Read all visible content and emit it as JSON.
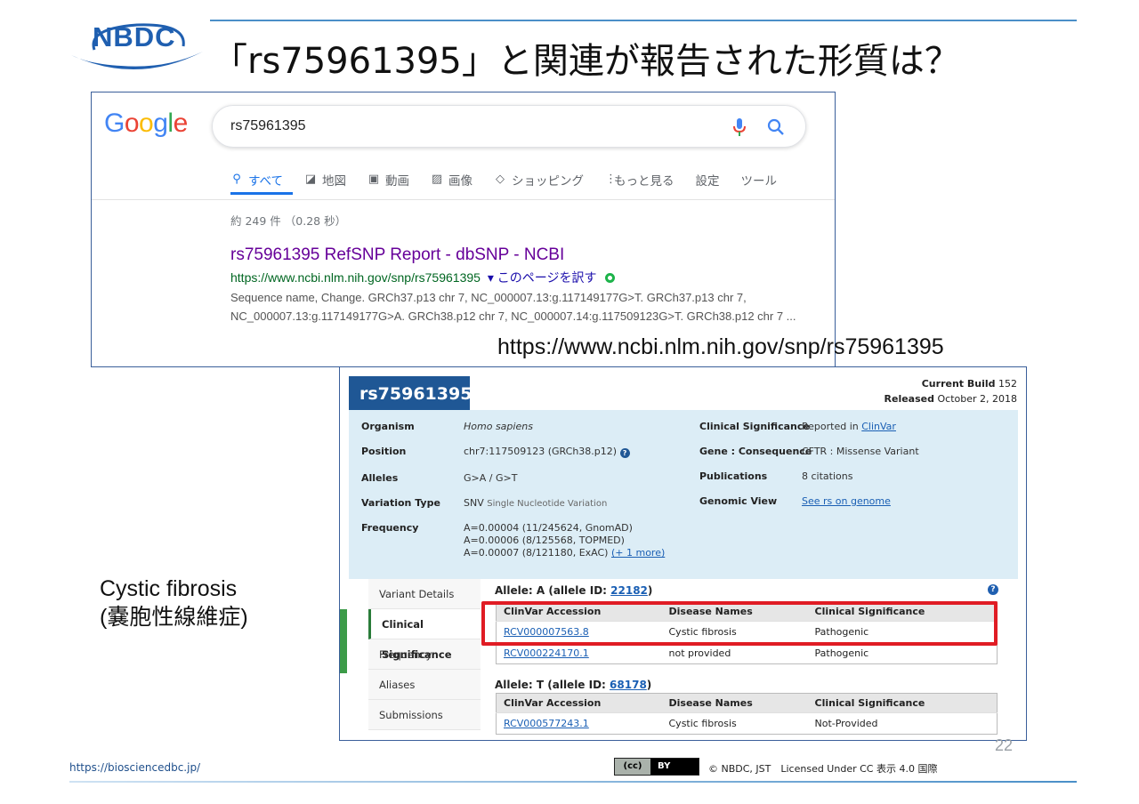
{
  "slide": {
    "logo_text": "NBDC",
    "title": "「rs75961395」と関連が報告された形質は？",
    "page_number": "22",
    "url_caption": "https://www.ncbi.nlm.nih.gov/snp/rs75961395",
    "disease_caption_line1": "Cystic fibrosis",
    "disease_caption_line2": "(嚢胞性線維症)",
    "footer_url": "https://biosciencedbc.jp/",
    "license_text": "© NBDC, JST　Licensed Under CC 表示 4.0 国際",
    "cc_badge_left": "(cc)",
    "cc_badge_right": "BY",
    "colors": {
      "accent": "#1f5fb0",
      "highlight": "#e01c24"
    }
  },
  "google": {
    "logo": [
      "G",
      "o",
      "o",
      "g",
      "l",
      "e"
    ],
    "logo_colors": [
      "#4285f4",
      "#ea4335",
      "#fbbc05",
      "#4285f4",
      "#34a853",
      "#ea4335"
    ],
    "search_value": "rs75961395",
    "tabs": [
      {
        "icon": "search-icon",
        "label": "すべて",
        "active": true
      },
      {
        "icon": "map-icon",
        "label": "地図"
      },
      {
        "icon": "video-icon",
        "label": "動画"
      },
      {
        "icon": "image-icon",
        "label": "画像"
      },
      {
        "icon": "tag-icon",
        "label": "ショッピング"
      },
      {
        "icon": "more-icon",
        "label": "もっと見る"
      },
      {
        "icon": "",
        "label": "設定"
      },
      {
        "icon": "",
        "label": "ツール"
      }
    ],
    "stats": "約 249 件 （0.28 秒）",
    "result": {
      "title": "rs75961395 RefSNP Report - dbSNP - NCBI",
      "url": "https://www.ncbi.nlm.nih.gov/snp/rs75961395",
      "translate": "▾ このページを訳す",
      "snippet": "Sequence name, Change. GRCh37.p13 chr 7, NC_000007.13:g.117149177G>T. GRCh37.p13 chr 7, NC_000007.13:g.117149177G>A. GRCh38.p12 chr 7, NC_000007.14:g.117509123G>T. GRCh38.p12 chr 7 ..."
    }
  },
  "ncbi": {
    "rs_id": "rs75961395",
    "current_build_label": "Current Build",
    "current_build": "152",
    "released_label": "Released",
    "released": "October 2, 2018",
    "summary": {
      "organism_label": "Organism",
      "organism": "Homo sapiens",
      "position_label": "Position",
      "position": "chr7:117509123 (GRCh38.p12)",
      "alleles_label": "Alleles",
      "alleles": "G>A / G>T",
      "variation_type_label": "Variation Type",
      "variation_type": "SNV",
      "variation_type_desc": "Single Nucleotide Variation",
      "frequency_label": "Frequency",
      "frequency_lines": [
        "A=0.00004 (11/245624, GnomAD)",
        "A=0.00006 (8/125568, TOPMED)",
        "A=0.00007 (8/121180, ExAC)"
      ],
      "frequency_more": "(+ 1 more)",
      "clinical_label": "Clinical Significance",
      "clinical_prefix": "Reported in",
      "clinical_link": "ClinVar",
      "gene_label": "Gene : Consequence",
      "gene": "CFTR : Missense Variant",
      "publications_label": "Publications",
      "publications": "8 citations",
      "genomic_view_label": "Genomic View",
      "genomic_view": "See rs on genome"
    },
    "side_nav": [
      "Variant Details",
      "Clinical Significance",
      "Frequency",
      "Aliases",
      "Submissions"
    ],
    "allele_a": {
      "prefix": "Allele: A (allele ID:",
      "id": "22182",
      "suffix": ")",
      "headers": [
        "ClinVar Accession",
        "Disease Names",
        "Clinical Significance"
      ],
      "rows": [
        [
          "RCV000007563.8",
          "Cystic fibrosis",
          "Pathogenic"
        ],
        [
          "RCV000224170.1",
          "not provided",
          "Pathogenic"
        ]
      ]
    },
    "allele_t": {
      "prefix": "Allele: T (allele ID:",
      "id": "68178",
      "suffix": ")",
      "headers": [
        "ClinVar Accession",
        "Disease Names",
        "Clinical Significance"
      ],
      "rows": [
        [
          "RCV000577243.1",
          "Cystic fibrosis",
          "Not-Provided"
        ]
      ]
    }
  }
}
